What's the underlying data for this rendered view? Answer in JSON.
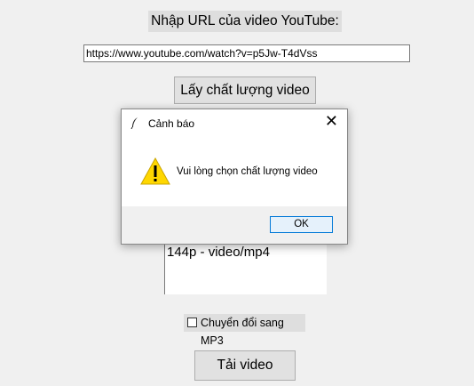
{
  "form": {
    "url_label": "Nhập URL của video YouTube:",
    "url_value": "https://www.youtube.com/watch?v=p5Jw-T4dVss",
    "quality_button": "Lấy chất lượng video",
    "quality_list": [
      "144p - video/mp4"
    ],
    "mp3_label": "Chuyển đổi sang MP3",
    "mp3_checked": false,
    "download_button": "Tải video"
  },
  "dialog": {
    "title": "Cảnh báo",
    "message": "Vui lòng chọn chất lượng video",
    "ok_label": "OK",
    "icon": "warning-icon",
    "window_icon": "feather-icon",
    "close_icon": "close-icon"
  },
  "colors": {
    "window_bg": "#f0f0f0",
    "warning_yellow": "#ffd700",
    "ok_border": "#0078d7"
  }
}
